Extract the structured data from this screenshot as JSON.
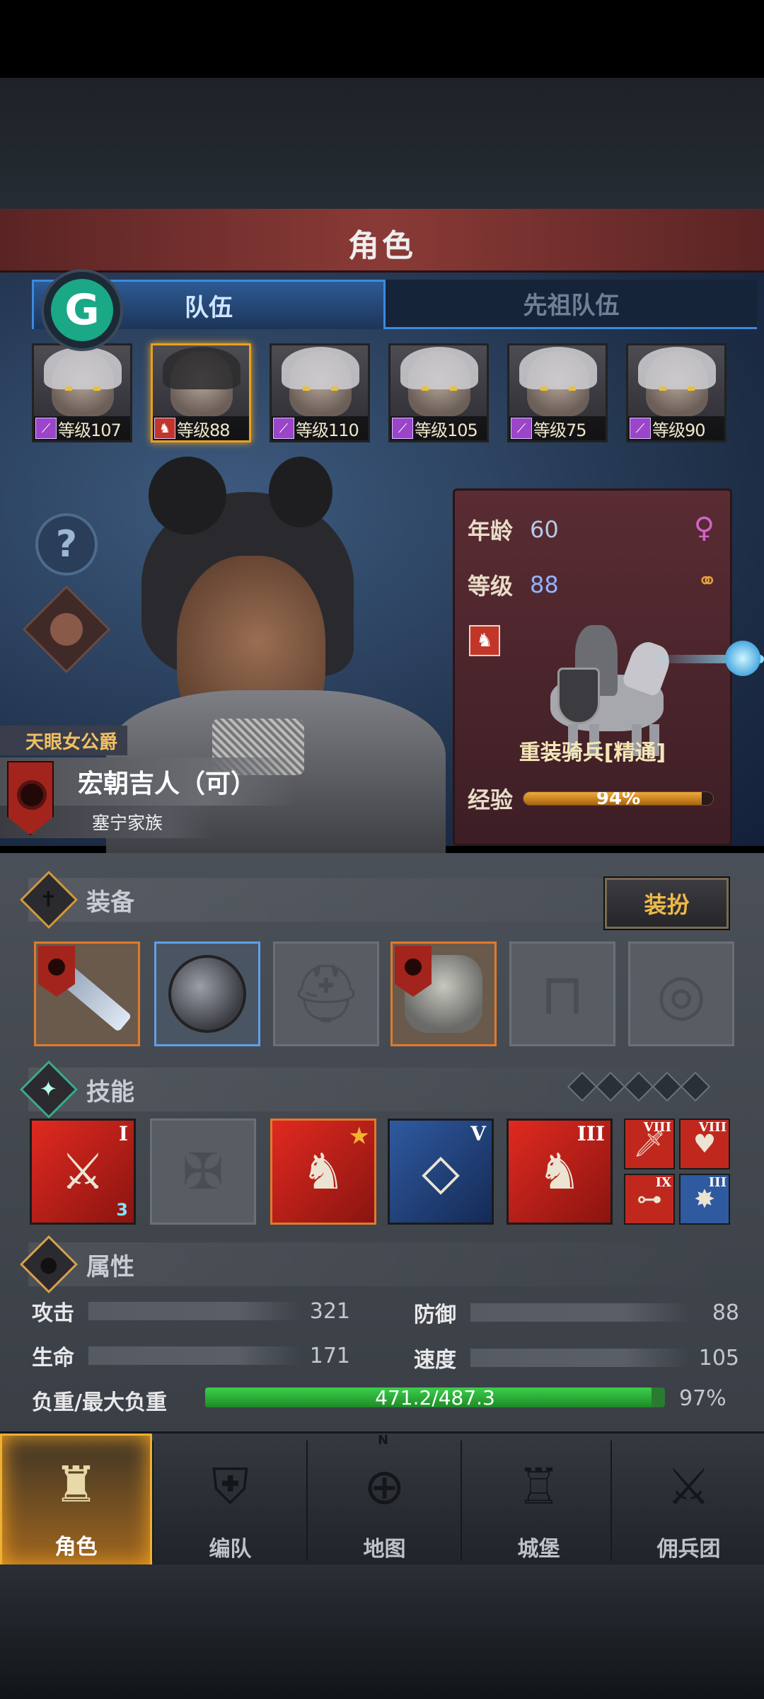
{
  "header": {
    "title": "角色"
  },
  "tabs": [
    {
      "label": "队伍"
    },
    {
      "label": "先祖队伍"
    }
  ],
  "badge": {
    "letter": "G",
    "color": "#1aa886"
  },
  "roster": [
    {
      "level": "等级107",
      "class_icon": "staff-icon"
    },
    {
      "level": "等级88",
      "class_icon": "horse-icon"
    },
    {
      "level": "等级110",
      "class_icon": "staff-icon"
    },
    {
      "level": "等级105",
      "class_icon": "staff-icon"
    },
    {
      "level": "等级75",
      "class_icon": "staff-icon"
    },
    {
      "level": "等级90",
      "class_icon": "staff-icon"
    }
  ],
  "character": {
    "title": "天眼女公爵",
    "name": "宏朝吉人（可）",
    "family": "塞宁家族"
  },
  "info": {
    "age_label": "年龄",
    "age": "60",
    "level_label": "等级",
    "level": "88",
    "unit_name": "重装骑兵[精通]",
    "exp_label": "经验",
    "exp": "94%",
    "exp_fraction": 0.94
  },
  "equipment": {
    "label": "装备",
    "dress_button": "装扮"
  },
  "skills": {
    "label": "技能",
    "items": [
      {
        "roman": "I",
        "sub": "3"
      },
      {
        "roman": ""
      },
      {
        "roman": ""
      },
      {
        "roman": "V"
      },
      {
        "roman": "III"
      }
    ],
    "mini": [
      "VIII",
      "VIII",
      "IX",
      "III"
    ]
  },
  "attributes": {
    "label": "属性",
    "attack_label": "攻击",
    "attack": "321",
    "defense_label": "防御",
    "defense": "88",
    "life_label": "生命",
    "life": "171",
    "speed_label": "速度",
    "speed": "105",
    "load_label": "负重/最大负重",
    "load": "471.2/487.3",
    "load_pct": "97%",
    "load_fraction": 0.97
  },
  "nav": [
    "角色",
    "编队",
    "地图",
    "城堡",
    "佣兵团"
  ],
  "colors": {
    "accent": "#f0b030",
    "header": "#8a3a36",
    "panel": "#2e5a94"
  }
}
